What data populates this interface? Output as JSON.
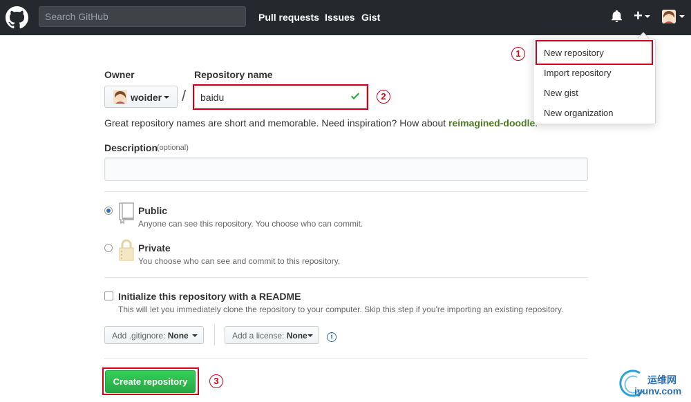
{
  "header": {
    "search_placeholder": "Search GitHub",
    "nav": [
      "Pull requests",
      "Issues",
      "Gist"
    ],
    "plus": "+"
  },
  "dropdown": {
    "items": [
      "New repository",
      "Import repository",
      "New gist",
      "New organization"
    ]
  },
  "markers": [
    "1",
    "2",
    "3"
  ],
  "form": {
    "owner_label": "Owner",
    "repo_label": "Repository name",
    "owner_value": "woider",
    "separator": "/",
    "repo_value": "baidu",
    "hint_prefix": "Great repository names are short and memorable. Need inspiration? How about ",
    "hint_name": "reimagined-doodle",
    "hint_suffix": ".",
    "description_label": "Description",
    "description_optional": "(optional)",
    "public_title": "Public",
    "public_desc": "Anyone can see this repository. You choose who can commit.",
    "private_title": "Private",
    "private_desc": "You choose who can see and commit to this repository.",
    "readme_title": "Initialize this repository with a README",
    "readme_desc": "This will let you immediately clone the repository to your computer. Skip this step if you're importing an existing repository.",
    "gitignore_label": "Add .gitignore:",
    "gitignore_value": "None",
    "license_label": "Add a license:",
    "license_value": "None",
    "info": "i",
    "create_button": "Create repository"
  },
  "watermark": {
    "line1": "运维网",
    "line2": "iyunv.com"
  },
  "colors": {
    "header_bg": "#25292e",
    "annotation_red": "#d0021b",
    "create_green": "#28a745",
    "hint_green": "#4c7a25"
  }
}
